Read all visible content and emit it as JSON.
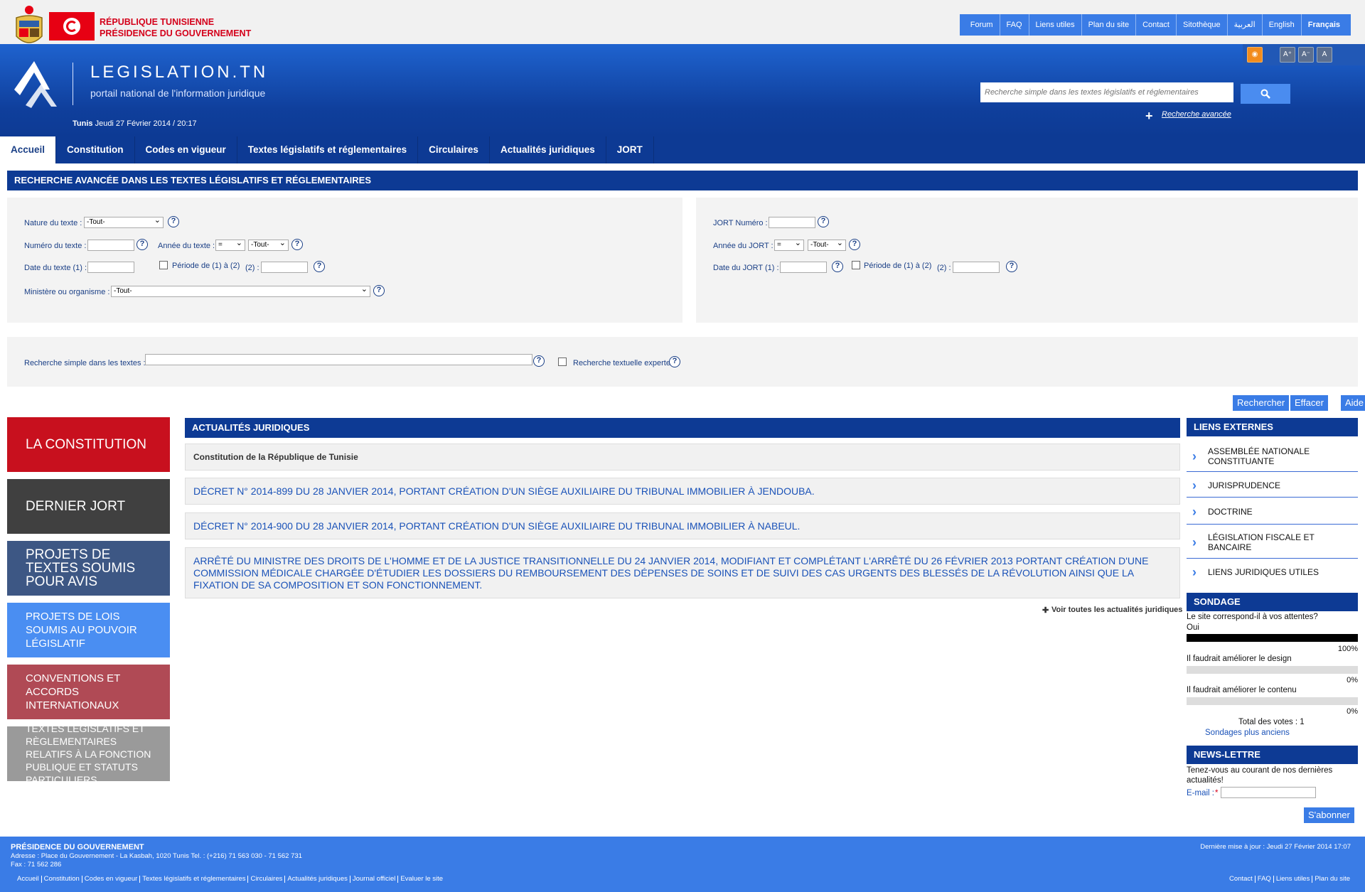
{
  "header": {
    "country": "RÉPUBLIQUE TUNISIENNE",
    "institution": "PRÉSIDENCE DU GOUVERNEMENT",
    "site_name": "LEGISLATION.TN",
    "site_subtitle": "portail national de l'information juridique",
    "datetime_city": "Tunis",
    "datetime": "Jeudi 27 Février 2014 / 20:17",
    "search_placeholder": "Recherche simple dans les textes législatifs et réglementaires",
    "advanced_search": "Recherche avancée",
    "top_links": [
      "Forum",
      "FAQ",
      "Liens utiles",
      "Plan du site",
      "Contact",
      "Sitothèque",
      "العربية",
      "English",
      "Français"
    ]
  },
  "nav": [
    "Accueil",
    "Constitution",
    "Codes en vigueur",
    "Textes législatifs et réglementaires",
    "Circulaires",
    "Actualités juridiques",
    "JORT"
  ],
  "advanced_form": {
    "title": "RECHERCHE AVANCÉE DANS LES TEXTES LÉGISLATIFS ET RÉGLEMENTAIRES",
    "nature_label": "Nature du texte :",
    "nature_value": "-Tout-",
    "numero_label": "Numéro du texte :",
    "annee_label": "Année du texte :",
    "annee_op": "=",
    "annee_value": "-Tout-",
    "date_label": "Date du texte (1) :",
    "periode_label": "Période de (1) à (2)",
    "two_label": "(2) :",
    "ministere_label": "Ministère ou organisme :",
    "ministere_value": "-Tout-",
    "jort_numero_label": "JORT Numéro :",
    "jort_annee_label": "Année du JORT :",
    "jort_annee_op": "=",
    "jort_annee_value": "-Tout-",
    "jort_date_label": "Date du JORT (1) :",
    "jort_periode_label": "Période de (1) à (2)",
    "jort_two_label": "(2) :",
    "simple_label": "Recherche simple dans les textes :",
    "expert_label": "Recherche textuelle experte",
    "help_glyph": "?",
    "buttons": [
      "Rechercher",
      "Effacer",
      "Aide"
    ]
  },
  "left_boxes": [
    {
      "label": "LA CONSTITUTION",
      "color": "#c8101e"
    },
    {
      "label": "DERNIER JORT",
      "color": "#404040"
    },
    {
      "label": "PROJETS DE TEXTES SOUMIS POUR AVIS",
      "color": "#3d5784"
    },
    {
      "label": "PROJETS DE LOIS SOUMIS AU POUVOIR LÉGISLATIF",
      "color": "#4a8ef2"
    },
    {
      "label": "CONVENTIONS ET ACCORDS INTERNATIONAUX",
      "color": "#b04a55"
    },
    {
      "label": "TEXTES LÉGISLATIFS ET RÈGLEMENTAIRES RELATIFS À LA FONCTION PUBLIQUE ET STATUTS PARTICULIERS",
      "color": "#9a9a9a"
    }
  ],
  "news": {
    "title": "ACTUALITÉS JURIDIQUES",
    "items": [
      "Constitution de la République de Tunisie",
      "DÉCRET N° 2014-899 DU 28 JANVIER 2014, PORTANT CRÉATION D'UN SIÈGE AUXILIAIRE DU TRIBUNAL IMMOBILIER À JENDOUBA.",
      "DÉCRET N° 2014-900 DU 28 JANVIER 2014, PORTANT CRÉATION D'UN SIÈGE AUXILIAIRE DU TRIBUNAL IMMOBILIER À NABEUL.",
      "ARRÊTÉ DU MINISTRE DES DROITS DE L'HOMME ET DE LA JUSTICE TRANSITIONNELLE DU 24 JANVIER 2014, MODIFIANT ET COMPLÉTANT L'ARRÊTÉ DU 26 FÉVRIER 2013 PORTANT CRÉATION D'UNE COMMISSION MÉDICALE CHARGÉE D'ÉTUDIER LES DOSSIERS DU REMBOURSEMENT DES DÉPENSES DE SOINS ET DE SUIVI DES CAS URGENTS DES BLESSÉS DE LA RÉVOLUTION AINSI QUE LA FIXATION DE SA COMPOSITION ET SON FONCTIONNEMENT."
    ],
    "more": "Voir toutes les actualités juridiques"
  },
  "external_links": {
    "title": "LIENS EXTERNES",
    "items": [
      "ASSEMBLÉE NATIONALE CONSTITUANTE",
      "JURISPRUDENCE",
      "DOCTRINE",
      "LÉGISLATION FISCALE ET BANCAIRE",
      "LIENS JURIDIQUES UTILES"
    ]
  },
  "poll": {
    "title": "SONDAGE",
    "question": "Le site correspond-il à vos attentes?",
    "options": [
      {
        "label": "Oui",
        "percent": 100,
        "percent_text": "100%"
      },
      {
        "label": "Il faudrait améliorer le design",
        "percent": 0,
        "percent_text": "0%"
      },
      {
        "label": "Il faudrait améliorer le contenu",
        "percent": 0,
        "percent_text": "0%"
      }
    ],
    "total": "Total des votes : 1",
    "older": "Sondages plus anciens"
  },
  "newsletter": {
    "title": "NEWS-LETTRE",
    "text": "Tenez-vous au courant de nos dernières actualités!",
    "email_label": "E-mail :",
    "required_mark": "*",
    "subscribe": "S'abonner"
  },
  "footer": {
    "institution": "PRÉSIDENCE DU GOUVERNEMENT",
    "address": "Adresse : Place du Gouvernement - La Kasbah, 1020 Tunis Tel. : (+216) 71 563 030 - 71 562 731",
    "fax": "Fax : 71 562 286",
    "updated": "Dernière mise à jour : Jeudi 27 Février 2014 17:07",
    "links_left": [
      "Accueil",
      "Constitution",
      "Codes en vigueur",
      "Textes législatifs et réglementaires",
      "Circulaires",
      "Actualités juridiques",
      "Journal officiel",
      "Evaluer le site"
    ],
    "links_right": [
      "Contact",
      "FAQ",
      "Liens utiles",
      "Plan du site"
    ]
  },
  "colors": {
    "brand_blue": "#0d3a94",
    "accent_blue": "#3a7ce6",
    "flag_red": "#e70013"
  }
}
